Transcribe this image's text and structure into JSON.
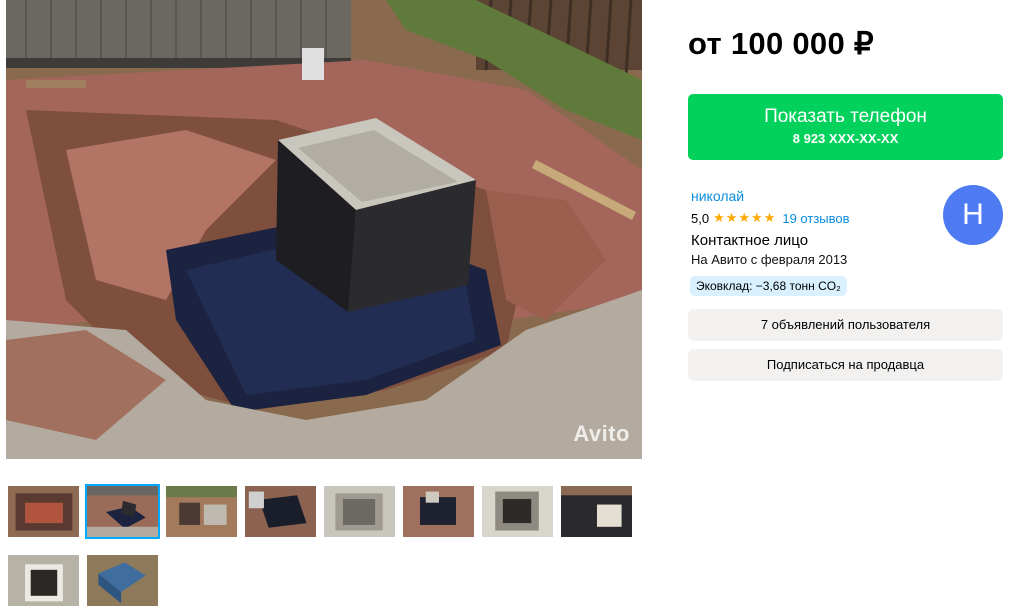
{
  "listing": {
    "price": "от 100 000 ₽",
    "watermark": "Avito"
  },
  "phone_button": {
    "label": "Показать телефон",
    "number": "8 923 XXX-XX-XX"
  },
  "seller": {
    "name": "николай",
    "rating": "5,0",
    "stars": "★★★★★",
    "reviews": "19 отзывов",
    "role": "Контактное лицо",
    "since": "На Авито с февраля 2013",
    "eco": "Эковклад: −3,68 тонн CO₂",
    "avatar_letter": "Н"
  },
  "buttons": {
    "user_ads": "7 объявлений пользователя",
    "subscribe": "Подписаться на продавца"
  },
  "gallery": {
    "active_index": 1,
    "thumb_count": 10
  },
  "colors": {
    "accent_green": "#02d15c",
    "link_blue": "#0a8ddd",
    "avatar_blue": "#4f7bf2",
    "star_orange": "#ffa800",
    "eco_bg": "#d9f0ff",
    "thumb_active_border": "#00aaff"
  }
}
